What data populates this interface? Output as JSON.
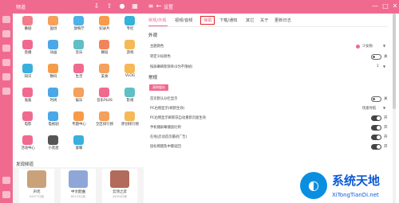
{
  "left_panel": {
    "title": "频道",
    "categories": [
      {
        "label": "番剧",
        "color": "#f47c8a"
      },
      {
        "label": "国创",
        "color": "#f5a05b"
      },
      {
        "label": "放映厅",
        "color": "#4fb1e6"
      },
      {
        "label": "纪录片",
        "color": "#f79b4a"
      },
      {
        "label": "专栏",
        "color": "#35b2d8"
      },
      {
        "label": "直播",
        "color": "#f06a8f"
      },
      {
        "label": "动画",
        "color": "#4aa8e8"
      },
      {
        "label": "音乐",
        "color": "#5ec0c6"
      },
      {
        "label": "舞蹈",
        "color": "#f0855b"
      },
      {
        "label": "游戏",
        "color": "#f7b955"
      },
      {
        "label": "知识",
        "color": "#38b0de"
      },
      {
        "label": "数码",
        "color": "#f59c4a"
      },
      {
        "label": "生活",
        "color": "#f06a8f"
      },
      {
        "label": "美食",
        "color": "#f5a05b"
      },
      {
        "label": "VLOG",
        "color": "#f7b955"
      },
      {
        "label": "鬼畜",
        "color": "#f06a8f"
      },
      {
        "label": "时尚",
        "color": "#4aa8e8"
      },
      {
        "label": "娱乐",
        "color": "#f5a05b"
      },
      {
        "label": "音乐PLUS",
        "color": "#f06a8f"
      },
      {
        "label": "影视",
        "color": "#5ec0c6"
      },
      {
        "label": "电影",
        "color": "#f06a8f"
      },
      {
        "label": "电视剧",
        "color": "#4aa8e8"
      },
      {
        "label": "专题中心",
        "color": "#f79b4a"
      },
      {
        "label": "全区排行榜",
        "color": "#f5a05b"
      },
      {
        "label": "原创排行榜",
        "color": "#f7b955"
      },
      {
        "label": "活动中心",
        "color": "#f06a8f"
      },
      {
        "label": "小黑屋",
        "color": "#555555"
      },
      {
        "label": "會暖",
        "color": "#38b0de"
      }
    ],
    "discover_title": "发现频道",
    "cards": [
      {
        "title": "声优",
        "sub": "54377订阅",
        "color": "#c9a27a"
      },
      {
        "title": "中文配曲",
        "sub": "60133订阅",
        "color": "#8ea7d8"
      },
      {
        "title": "云顶之弈",
        "sub": "44954订阅",
        "color": "#b26b5a"
      }
    ]
  },
  "right_panel": {
    "title": "设置",
    "tabs": [
      "常规/外观",
      "视频/音频",
      "弹幕",
      "下载/通知",
      "其它",
      "关于",
      "更新日志"
    ],
    "appearance_heading": "外观",
    "theme_label": "主题颜色",
    "theme_value": "少女粉",
    "theme_color": "#f06a8f",
    "row2_label": "转定义标颜色",
    "row2_value": "关",
    "row3_label": "按屏幕刷新频率(0为不限帧)",
    "row3_value": "1",
    "general_heading": "常规",
    "clear_cache_label": "清除缓存",
    "rows": [
      {
        "label": "首页默认分栏显示",
        "value": "关",
        "on": false
      },
      {
        "label": "PC右侧显示(刷新生效)",
        "value": "快速导航",
        "dropdown": true
      },
      {
        "label": "PC右侧显示刷新前自动重新页面生效",
        "value": "开",
        "on": true
      },
      {
        "label": "手机播屏幕播放比例",
        "value": "开",
        "on": true
      },
      {
        "label": "在线(启动首页最初广告)",
        "value": "开",
        "on": true
      },
      {
        "label": "鼠标侧键及中键返回",
        "value": "开",
        "on": true
      }
    ]
  },
  "watermark": {
    "title": "系统天地",
    "url": "XiTongTianDi.net"
  }
}
